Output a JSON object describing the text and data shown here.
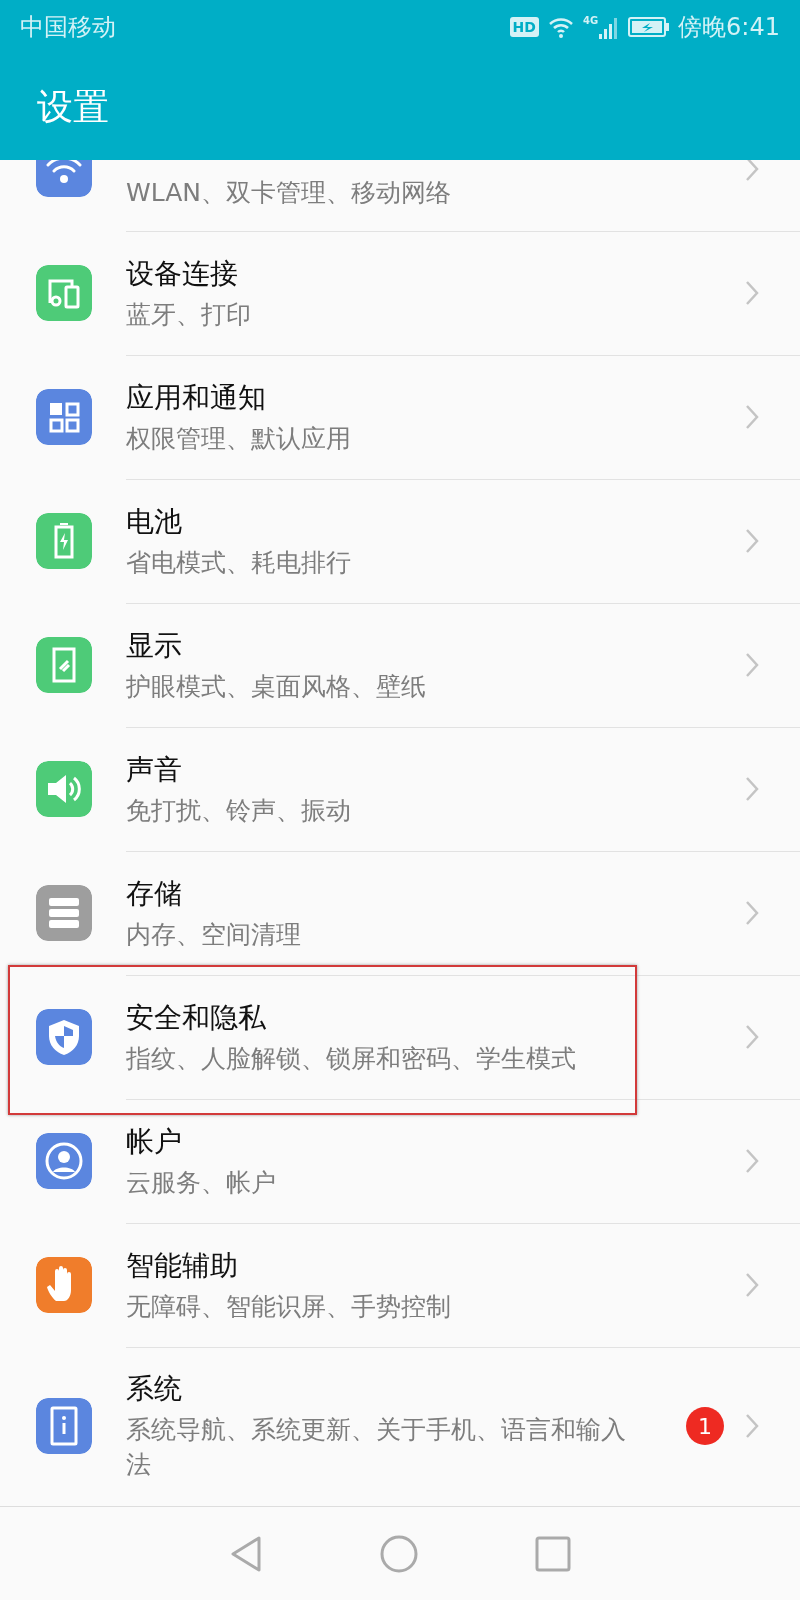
{
  "status_bar": {
    "carrier": "中国移动",
    "hd_label": "HD",
    "network": "4G",
    "time": "傍晚6:41"
  },
  "app_bar": {
    "title": "设置"
  },
  "items": [
    {
      "subtitle": "WLAN、双卡管理、移动网络",
      "color": "#5b86df",
      "highlighted": false
    },
    {
      "title": "设备连接",
      "subtitle": "蓝牙、打印",
      "color": "#4ecb78",
      "highlighted": false
    },
    {
      "title": "应用和通知",
      "subtitle": "权限管理、默认应用",
      "color": "#5b86df",
      "highlighted": false
    },
    {
      "title": "电池",
      "subtitle": "省电模式、耗电排行",
      "color": "#4ecb78",
      "highlighted": false
    },
    {
      "title": "显示",
      "subtitle": "护眼模式、桌面风格、壁纸",
      "color": "#4ecb78",
      "highlighted": false
    },
    {
      "title": "声音",
      "subtitle": "免打扰、铃声、振动",
      "color": "#4ecb78",
      "highlighted": false
    },
    {
      "title": "存储",
      "subtitle": "内存、空间清理",
      "color": "#9e9e9e",
      "highlighted": false
    },
    {
      "title": "安全和隐私",
      "subtitle": "指纹、人脸解锁、锁屏和密码、学生模式",
      "color": "#5b86df",
      "highlighted": true
    },
    {
      "title": "帐户",
      "subtitle": "云服务、帐户",
      "color": "#5b86df",
      "highlighted": false
    },
    {
      "title": "智能辅助",
      "subtitle": "无障碍、智能识屏、手势控制",
      "color": "#f07d2b",
      "highlighted": false
    },
    {
      "title": "系统",
      "subtitle": "系统导航、系统更新、关于手机、语言和输入法",
      "color": "#5b86df",
      "highlighted": false,
      "badge": "1"
    }
  ]
}
